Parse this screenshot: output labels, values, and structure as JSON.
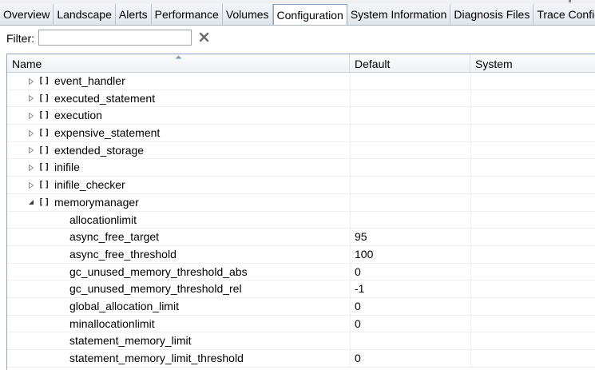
{
  "tabs": [
    {
      "label": "Overview",
      "active": false
    },
    {
      "label": "Landscape",
      "active": false
    },
    {
      "label": "Alerts",
      "active": false
    },
    {
      "label": "Performance",
      "active": false
    },
    {
      "label": "Volumes",
      "active": false
    },
    {
      "label": "Configuration",
      "active": true
    },
    {
      "label": "System Information",
      "active": false
    },
    {
      "label": "Diagnosis Files",
      "active": false
    },
    {
      "label": "Trace Configu",
      "active": false
    }
  ],
  "filter": {
    "label": "Filter:",
    "value": "",
    "placeholder": ""
  },
  "table": {
    "columns": [
      "Name",
      "Default",
      "System"
    ],
    "sort_icon": "sort-ascending-icon",
    "rows": [
      {
        "kind": "section",
        "expanded": false,
        "name": "event_handler",
        "default": "",
        "system": ""
      },
      {
        "kind": "section",
        "expanded": false,
        "name": "executed_statement",
        "default": "",
        "system": ""
      },
      {
        "kind": "section",
        "expanded": false,
        "name": "execution",
        "default": "",
        "system": ""
      },
      {
        "kind": "section",
        "expanded": false,
        "name": "expensive_statement",
        "default": "",
        "system": ""
      },
      {
        "kind": "section",
        "expanded": false,
        "name": "extended_storage",
        "default": "",
        "system": ""
      },
      {
        "kind": "section",
        "expanded": false,
        "name": "inifile",
        "default": "",
        "system": ""
      },
      {
        "kind": "section",
        "expanded": false,
        "name": "inifile_checker",
        "default": "",
        "system": ""
      },
      {
        "kind": "section",
        "expanded": true,
        "name": "memorymanager",
        "default": "",
        "system": ""
      },
      {
        "kind": "param",
        "name": "allocationlimit",
        "default": "",
        "system": ""
      },
      {
        "kind": "param",
        "name": "async_free_target",
        "default": "95",
        "system": ""
      },
      {
        "kind": "param",
        "name": "async_free_threshold",
        "default": "100",
        "system": ""
      },
      {
        "kind": "param",
        "name": "gc_unused_memory_threshold_abs",
        "default": "0",
        "system": ""
      },
      {
        "kind": "param",
        "name": "gc_unused_memory_threshold_rel",
        "default": "-1",
        "system": ""
      },
      {
        "kind": "param",
        "name": "global_allocation_limit",
        "default": "0",
        "system": ""
      },
      {
        "kind": "param",
        "name": "minallocationlimit",
        "default": "0",
        "system": ""
      },
      {
        "kind": "param",
        "name": "statement_memory_limit",
        "default": "",
        "system": ""
      },
      {
        "kind": "param",
        "name": "statement_memory_limit_threshold",
        "default": "0",
        "system": ""
      }
    ]
  },
  "icons": {
    "clear": "clear-filter-icon",
    "collapsed": "expand-arrow-icon",
    "expanded": "collapse-arrow-icon",
    "section": "bracket-section-icon"
  },
  "colors": {
    "tab_border": "#8aa6c8",
    "grid_line": "#eceef1"
  }
}
